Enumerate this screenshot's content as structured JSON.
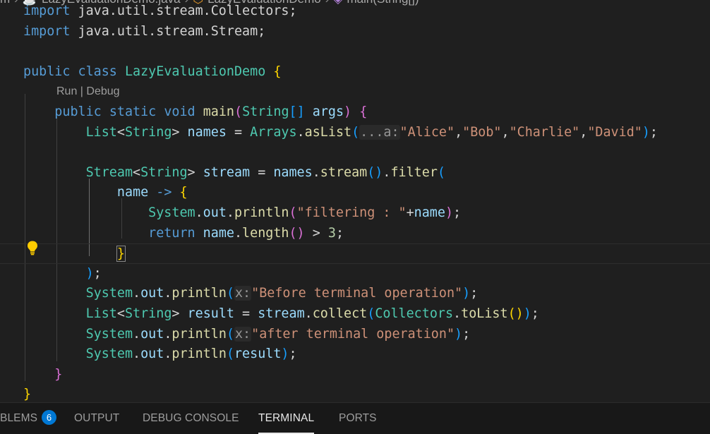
{
  "breadcrumb": {
    "segments": [
      "m",
      "LazyEvaluationDemo.java",
      "LazyEvaluationDemo",
      "main(String[])"
    ],
    "icons": [
      "java-file-icon",
      "class-icon",
      "method-icon"
    ]
  },
  "editor": {
    "codelens": "Run | Debug",
    "lines": [
      {
        "tokens": [
          [
            "kw",
            "import"
          ],
          [
            "op",
            " java.util.stream.Collectors;"
          ]
        ]
      },
      {
        "tokens": [
          [
            "kw",
            "import"
          ],
          [
            "op",
            " java.util.stream.Stream;"
          ]
        ]
      },
      {
        "tokens": []
      },
      {
        "tokens": [
          [
            "kw",
            "public"
          ],
          [
            "op",
            " "
          ],
          [
            "kw",
            "class"
          ],
          [
            "op",
            " "
          ],
          [
            "ty",
            "LazyEvaluationDemo"
          ],
          [
            "op",
            " "
          ],
          [
            "b1",
            "{"
          ]
        ]
      },
      {
        "codelens": true
      },
      {
        "tokens": [
          [
            "op",
            "    "
          ],
          [
            "kw",
            "public"
          ],
          [
            "op",
            " "
          ],
          [
            "kw",
            "static"
          ],
          [
            "op",
            " "
          ],
          [
            "kw",
            "void"
          ],
          [
            "op",
            " "
          ],
          [
            "fn",
            "main"
          ],
          [
            "b2",
            "("
          ],
          [
            "ty",
            "String"
          ],
          [
            "b3",
            "[]"
          ],
          [
            "op",
            " "
          ],
          [
            "vr",
            "args"
          ],
          [
            "b2",
            ")"
          ],
          [
            "op",
            " "
          ],
          [
            "b2",
            "{"
          ]
        ]
      },
      {
        "tokens": [
          [
            "op",
            "        "
          ],
          [
            "ty",
            "List"
          ],
          [
            "op",
            "<"
          ],
          [
            "ty",
            "String"
          ],
          [
            "op",
            "> "
          ],
          [
            "vr",
            "names"
          ],
          [
            "op",
            " = "
          ],
          [
            "ty",
            "Arrays"
          ],
          [
            "op",
            "."
          ],
          [
            "fn",
            "asList"
          ],
          [
            "b3",
            "("
          ],
          [
            "hint",
            "...a:"
          ],
          [
            "st",
            "\"Alice\""
          ],
          [
            "op",
            ","
          ],
          [
            "st",
            "\"Bob\""
          ],
          [
            "op",
            ","
          ],
          [
            "st",
            "\"Charlie\""
          ],
          [
            "op",
            ","
          ],
          [
            "st",
            "\"David\""
          ],
          [
            "b3",
            ")"
          ],
          [
            "op",
            ";"
          ]
        ]
      },
      {
        "tokens": []
      },
      {
        "tokens": [
          [
            "op",
            "        "
          ],
          [
            "ty",
            "Stream"
          ],
          [
            "op",
            "<"
          ],
          [
            "ty",
            "String"
          ],
          [
            "op",
            "> "
          ],
          [
            "vr",
            "stream"
          ],
          [
            "op",
            " = "
          ],
          [
            "vr",
            "names"
          ],
          [
            "op",
            "."
          ],
          [
            "fn",
            "stream"
          ],
          [
            "b3",
            "()"
          ],
          [
            "op",
            "."
          ],
          [
            "fn",
            "filter"
          ],
          [
            "b3",
            "("
          ]
        ]
      },
      {
        "tokens": [
          [
            "op",
            "            "
          ],
          [
            "vr",
            "name"
          ],
          [
            "op",
            " "
          ],
          [
            "kw",
            "->"
          ],
          [
            "op",
            " "
          ],
          [
            "b1",
            "{"
          ]
        ]
      },
      {
        "tokens": [
          [
            "op",
            "                "
          ],
          [
            "ty",
            "System"
          ],
          [
            "op",
            "."
          ],
          [
            "vr",
            "out"
          ],
          [
            "op",
            "."
          ],
          [
            "fn",
            "println"
          ],
          [
            "b2",
            "("
          ],
          [
            "st",
            "\"filtering : \""
          ],
          [
            "op",
            "+"
          ],
          [
            "vr",
            "name"
          ],
          [
            "b2",
            ")"
          ],
          [
            "op",
            ";"
          ]
        ]
      },
      {
        "tokens": [
          [
            "op",
            "                "
          ],
          [
            "kw",
            "return"
          ],
          [
            "op",
            " "
          ],
          [
            "vr",
            "name"
          ],
          [
            "op",
            "."
          ],
          [
            "fn",
            "length"
          ],
          [
            "b2",
            "()"
          ],
          [
            "op",
            " > "
          ],
          [
            "nm",
            "3"
          ],
          [
            "op",
            ";"
          ]
        ]
      },
      {
        "tokens": [
          [
            "op",
            "            "
          ],
          [
            "b1hl",
            "}"
          ]
        ],
        "current": true
      },
      {
        "tokens": [
          [
            "op",
            "        "
          ],
          [
            "b3",
            ")"
          ],
          [
            "op",
            ";"
          ]
        ]
      },
      {
        "tokens": [
          [
            "op",
            "        "
          ],
          [
            "ty",
            "System"
          ],
          [
            "op",
            "."
          ],
          [
            "vr",
            "out"
          ],
          [
            "op",
            "."
          ],
          [
            "fn",
            "println"
          ],
          [
            "b3",
            "("
          ],
          [
            "hint",
            "x:"
          ],
          [
            "st",
            "\"Before terminal operation\""
          ],
          [
            "b3",
            ")"
          ],
          [
            "op",
            ";"
          ]
        ]
      },
      {
        "tokens": [
          [
            "op",
            "        "
          ],
          [
            "ty",
            "List"
          ],
          [
            "op",
            "<"
          ],
          [
            "ty",
            "String"
          ],
          [
            "op",
            "> "
          ],
          [
            "vr",
            "result"
          ],
          [
            "op",
            " = "
          ],
          [
            "vr",
            "stream"
          ],
          [
            "op",
            "."
          ],
          [
            "fn",
            "collect"
          ],
          [
            "b3",
            "("
          ],
          [
            "ty",
            "Collectors"
          ],
          [
            "op",
            "."
          ],
          [
            "fn",
            "toList"
          ],
          [
            "b1",
            "()"
          ],
          [
            "b3",
            ")"
          ],
          [
            "op",
            ";"
          ]
        ]
      },
      {
        "tokens": [
          [
            "op",
            "        "
          ],
          [
            "ty",
            "System"
          ],
          [
            "op",
            "."
          ],
          [
            "vr",
            "out"
          ],
          [
            "op",
            "."
          ],
          [
            "fn",
            "println"
          ],
          [
            "b3",
            "("
          ],
          [
            "hint",
            "x:"
          ],
          [
            "st",
            "\"after terminal operation\""
          ],
          [
            "b3",
            ")"
          ],
          [
            "op",
            ";"
          ]
        ]
      },
      {
        "tokens": [
          [
            "op",
            "        "
          ],
          [
            "ty",
            "System"
          ],
          [
            "op",
            "."
          ],
          [
            "vr",
            "out"
          ],
          [
            "op",
            "."
          ],
          [
            "fn",
            "println"
          ],
          [
            "b3",
            "("
          ],
          [
            "vr",
            "result"
          ],
          [
            "b3",
            ")"
          ],
          [
            "op",
            ";"
          ]
        ]
      },
      {
        "tokens": [
          [
            "op",
            "    "
          ],
          [
            "b2",
            "}"
          ]
        ]
      },
      {
        "tokens": [
          [
            "b1",
            "}"
          ]
        ]
      }
    ]
  },
  "panel": {
    "tabs": [
      {
        "label": "BLEMS",
        "badge": "6",
        "active": false
      },
      {
        "label": "OUTPUT",
        "active": false
      },
      {
        "label": "DEBUG CONSOLE",
        "active": false
      },
      {
        "label": "TERMINAL",
        "active": true
      },
      {
        "label": "PORTS",
        "active": false
      }
    ]
  },
  "colors": {
    "background": "#1f1f1f",
    "keyword": "#569cd6",
    "type": "#4ec9b0",
    "function": "#dcdcaa",
    "variable": "#9cdcfe",
    "string": "#ce9178",
    "badge": "#0078d4"
  }
}
